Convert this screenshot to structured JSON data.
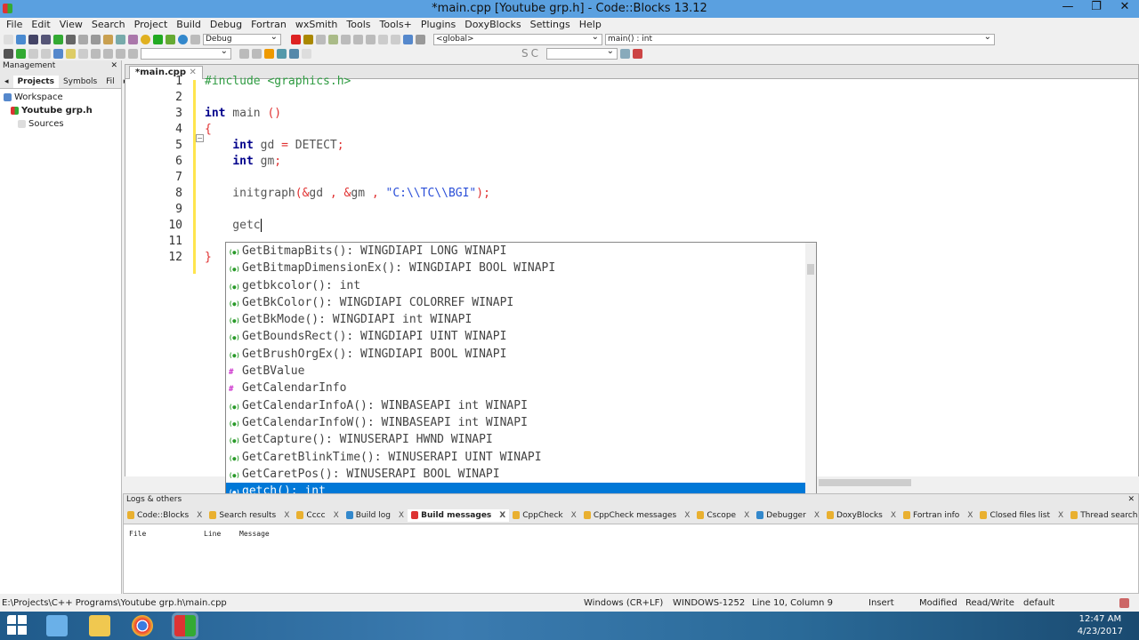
{
  "window": {
    "title": "*main.cpp [Youtube grp.h] - Code::Blocks 13.12"
  },
  "menu": [
    "File",
    "Edit",
    "View",
    "Search",
    "Project",
    "Build",
    "Debug",
    "Fortran",
    "wxSmith",
    "Tools",
    "Tools+",
    "Plugins",
    "DoxyBlocks",
    "Settings",
    "Help"
  ],
  "toolbar": {
    "build_target": "Debug",
    "scope": "<global>",
    "function": "main() : int",
    "search_value": "",
    "symbol_s": "S",
    "symbol_c": "C"
  },
  "management": {
    "title": "Management",
    "tabs": [
      "Projects",
      "Symbols",
      "Fil"
    ],
    "active_tab": "Projects",
    "tree": [
      {
        "label": "Workspace",
        "level": 0
      },
      {
        "label": "Youtube grp.h",
        "level": 1,
        "bold": true
      },
      {
        "label": "Sources",
        "level": 2
      }
    ]
  },
  "editor": {
    "tab": "*main.cpp",
    "lines": [
      [
        [
          "pp",
          "#include <graphics.h>"
        ]
      ],
      [],
      [
        [
          "kw",
          "int"
        ],
        [
          "pl",
          " main "
        ],
        [
          "op",
          "()"
        ]
      ],
      [
        [
          "op",
          "{"
        ]
      ],
      [
        [
          "pl",
          "    "
        ],
        [
          "kw",
          "int"
        ],
        [
          "pl",
          " gd "
        ],
        [
          "op",
          "="
        ],
        [
          "pl",
          " DETECT"
        ],
        [
          "op",
          ";"
        ]
      ],
      [
        [
          "pl",
          "    "
        ],
        [
          "kw",
          "int"
        ],
        [
          "pl",
          " gm"
        ],
        [
          "op",
          ";"
        ]
      ],
      [],
      [
        [
          "pl",
          "    initgraph"
        ],
        [
          "op",
          "(&"
        ],
        [
          "pl",
          "gd "
        ],
        [
          "op",
          ", &"
        ],
        [
          "pl",
          "gm "
        ],
        [
          "op",
          ", "
        ],
        [
          "str",
          "\"C:\\\\TC\\\\BGI\""
        ],
        [
          "op",
          ");"
        ]
      ],
      [],
      [
        [
          "pl",
          "    getc"
        ]
      ],
      [],
      [
        [
          "op",
          "}"
        ]
      ]
    ]
  },
  "autocomplete": {
    "items": [
      {
        "kind": "function",
        "text": "GetBitmapBits(): WINGDIAPI LONG WINAPI"
      },
      {
        "kind": "function",
        "text": "GetBitmapDimensionEx(): WINGDIAPI BOOL WINAPI"
      },
      {
        "kind": "function",
        "text": "getbkcolor(): int"
      },
      {
        "kind": "function",
        "text": "GetBkColor(): WINGDIAPI COLORREF WINAPI"
      },
      {
        "kind": "function",
        "text": "GetBkMode(): WINGDIAPI int WINAPI"
      },
      {
        "kind": "function",
        "text": "GetBoundsRect(): WINGDIAPI UINT WINAPI"
      },
      {
        "kind": "function",
        "text": "GetBrushOrgEx(): WINGDIAPI BOOL WINAPI"
      },
      {
        "kind": "macro",
        "text": "GetBValue"
      },
      {
        "kind": "macro",
        "text": "GetCalendarInfo"
      },
      {
        "kind": "function",
        "text": "GetCalendarInfoA(): WINBASEAPI int WINAPI"
      },
      {
        "kind": "function",
        "text": "GetCalendarInfoW(): WINBASEAPI int WINAPI"
      },
      {
        "kind": "function",
        "text": "GetCapture(): WINUSERAPI HWND WINAPI"
      },
      {
        "kind": "function",
        "text": "GetCaretBlinkTime(): WINUSERAPI UINT WINAPI"
      },
      {
        "kind": "function",
        "text": "GetCaretPos(): WINUSERAPI BOOL WINAPI"
      },
      {
        "kind": "function",
        "text": "getch(): int",
        "selected": true
      }
    ]
  },
  "logs": {
    "title": "Logs & others",
    "tabs": [
      "Code::Blocks",
      "Search results",
      "Cccc",
      "Build log",
      "Build messages",
      "CppCheck",
      "CppCheck messages",
      "Cscope",
      "Debugger",
      "DoxyBlocks",
      "Fortran info",
      "Closed files list",
      "Thread search"
    ],
    "active_tab": "Build messages",
    "columns": [
      "File",
      "Line",
      "Message"
    ]
  },
  "status": {
    "path": "E:\\Projects\\C++ Programs\\Youtube grp.h\\main.cpp",
    "eol": "Windows (CR+LF)",
    "encoding": "WINDOWS-1252",
    "position": "Line 10, Column 9",
    "mode": "Insert",
    "modified": "Modified",
    "access": "Read/Write",
    "profile": "default"
  },
  "taskbar": {
    "time": "12:47 AM",
    "date": "4/23/2017"
  },
  "colors": {
    "accent": "#0078d7",
    "keyword": "#00008b",
    "preprocessor": "#2e9b41",
    "operator": "#e03030",
    "string": "#2b4fd8",
    "caret_marker": "#ffe54d"
  }
}
